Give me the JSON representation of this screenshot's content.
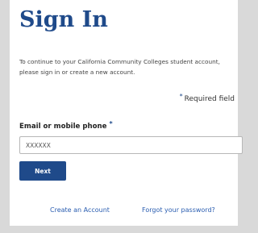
{
  "page": {
    "title": "Sign In",
    "intro": "To continue to your California Community Colleges student account, please sign in or create a new account.",
    "required_star": "*",
    "required_note": "Required field"
  },
  "form": {
    "email_label": "Email or mobile phone",
    "email_value": "XXXXXX",
    "next_label": "Next"
  },
  "links": {
    "create_account": "Create an Account",
    "forgot_password": "Forgot your password?"
  },
  "colors": {
    "brand": "#1f4a8a",
    "link": "#2a5db0",
    "background": "#d9d9d9"
  }
}
